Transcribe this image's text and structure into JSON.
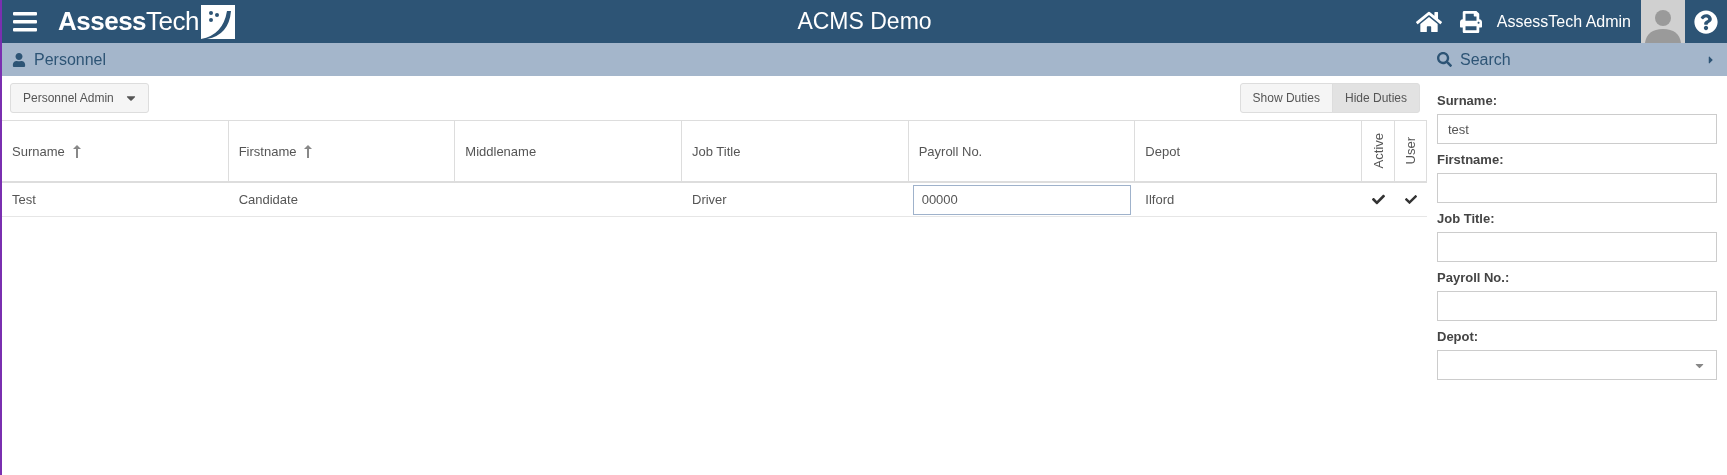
{
  "header": {
    "logo": "**Assess**Tech",
    "title": "ACMS Demo",
    "user_name": "AssessTech Admin"
  },
  "subheader": {
    "section": "Personnel",
    "search_title": "Search"
  },
  "toolbar": {
    "dropdown": "Personnel Admin",
    "toggle_buttons": [
      {
        "label": "Show Duties",
        "selected": false
      },
      {
        "label": "Hide Duties",
        "selected": true
      }
    ]
  },
  "table": {
    "columns": [
      {
        "label": "Surname",
        "sorted": true,
        "vertical": false
      },
      {
        "label": "Firstname",
        "sorted": true,
        "vertical": false
      },
      {
        "label": "Middlename",
        "sorted": false,
        "vertical": false
      },
      {
        "label": "Job Title",
        "sorted": false,
        "vertical": false
      },
      {
        "label": "Payroll No.",
        "sorted": false,
        "vertical": false
      },
      {
        "label": "Depot",
        "sorted": false,
        "vertical": false
      },
      {
        "label": "Active",
        "sorted": false,
        "vertical": true
      },
      {
        "label": "User",
        "sorted": false,
        "vertical": true
      }
    ],
    "rows": [
      {
        "cells": [
          {
            "kind": "text",
            "value": "Test"
          },
          {
            "kind": "text",
            "value": "Candidate"
          },
          {
            "kind": "text"
          },
          {
            "kind": "text",
            "value": "Driver"
          },
          {
            "kind": "input",
            "value": "00000"
          },
          {
            "kind": "text",
            "value": "Ilford"
          },
          {
            "kind": "check",
            "checked": true
          },
          {
            "kind": "check",
            "checked": true
          }
        ]
      }
    ]
  },
  "search_form": {
    "fields": [
      {
        "label": "Surname:",
        "kind": "input",
        "value": "test"
      },
      {
        "label": "Firstname:",
        "kind": "input"
      },
      {
        "label": "Job Title:",
        "kind": "input"
      },
      {
        "label": "Payroll No.:",
        "kind": "input"
      },
      {
        "label": "Depot:",
        "kind": "select"
      }
    ]
  }
}
